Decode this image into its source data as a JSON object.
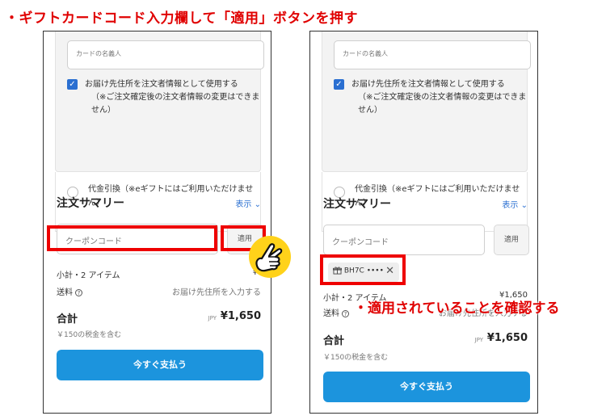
{
  "instructions": {
    "step1": "・ギフトカードコード入力欄して「適用」ボタンを押す",
    "step2": "・適用されていることを確認する"
  },
  "form": {
    "cardholder_placeholder": "カードの名義人",
    "use_shipping_checkbox": {
      "checked": true,
      "label": "お届け先住所を注文者情報として使用する",
      "sub": "（※ご注文確定後の注文者情報の変更はできません）"
    },
    "cod_option": {
      "selected": false,
      "label": "代金引換（※eギフトにはご利用いただけません）"
    }
  },
  "summary": {
    "title": "注文サマリー",
    "show_link": "表示",
    "coupon_placeholder": "クーポンコード",
    "apply_label": "適用",
    "applied_code": "BH7C ••••",
    "subtotal_label": "小計・2 アイテム",
    "subtotal_value_partial": "¥",
    "subtotal_value": "¥1,650",
    "shipping_label": "送料",
    "shipping_value": "お届け先住所を入力する",
    "total_label": "合計",
    "currency": "JPY",
    "total_value": "¥1,650",
    "tax_note": "￥150の税金を含む",
    "pay_button": "今すぐ支払う"
  },
  "colors": {
    "accent_red": "#ee0000",
    "primary_blue": "#1c94dd",
    "link_blue": "#2a6fd1",
    "pointer_yellow": "#ffd21a"
  }
}
